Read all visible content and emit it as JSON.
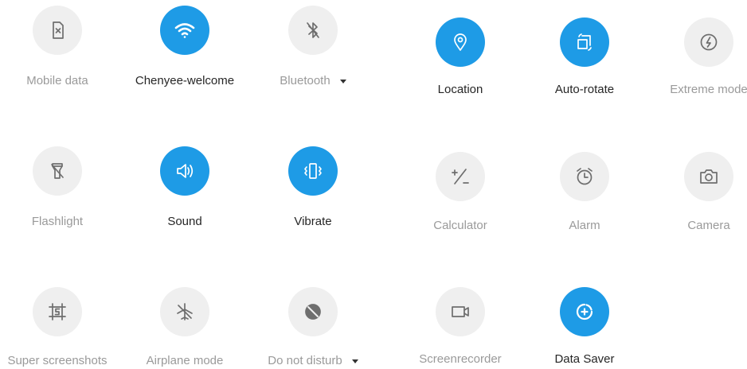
{
  "colors": {
    "active": "#1e9be6",
    "inactive_bg": "#efefef",
    "inactive_icon": "#6e6e6e",
    "active_label": "#262626",
    "inactive_label": "#9a9a9a"
  },
  "tiles": [
    {
      "label": "Mobile data",
      "icon": "sim-off-icon",
      "active": false
    },
    {
      "label": "Chenyee-welcome",
      "icon": "wifi-icon",
      "active": true
    },
    {
      "label": "Bluetooth",
      "icon": "bluetooth-off-icon",
      "active": false,
      "dropdown": true
    },
    {
      "label": "Location",
      "icon": "location-pin-icon",
      "active": true
    },
    {
      "label": "Auto-rotate",
      "icon": "auto-rotate-icon",
      "active": true
    },
    {
      "label": "Extreme mode",
      "icon": "extreme-mode-icon",
      "active": false
    },
    {
      "label": "Flashlight",
      "icon": "flashlight-off-icon",
      "active": false
    },
    {
      "label": "Sound",
      "icon": "speaker-icon",
      "active": true
    },
    {
      "label": "Vibrate",
      "icon": "vibrate-icon",
      "active": true
    },
    {
      "label": "Calculator",
      "icon": "calculator-icon",
      "active": false
    },
    {
      "label": "Alarm",
      "icon": "alarm-clock-icon",
      "active": false
    },
    {
      "label": "Camera",
      "icon": "camera-icon",
      "active": false
    },
    {
      "label": "Super screenshots",
      "icon": "super-screenshot-icon",
      "active": false
    },
    {
      "label": "Airplane mode",
      "icon": "airplane-off-icon",
      "active": false
    },
    {
      "label": "Do not disturb",
      "icon": "do-not-disturb-icon",
      "active": false,
      "dropdown": true
    },
    {
      "label": "Screenrecorder",
      "icon": "screen-recorder-icon",
      "active": false
    },
    {
      "label": "Data Saver",
      "icon": "data-saver-icon",
      "active": true
    }
  ]
}
